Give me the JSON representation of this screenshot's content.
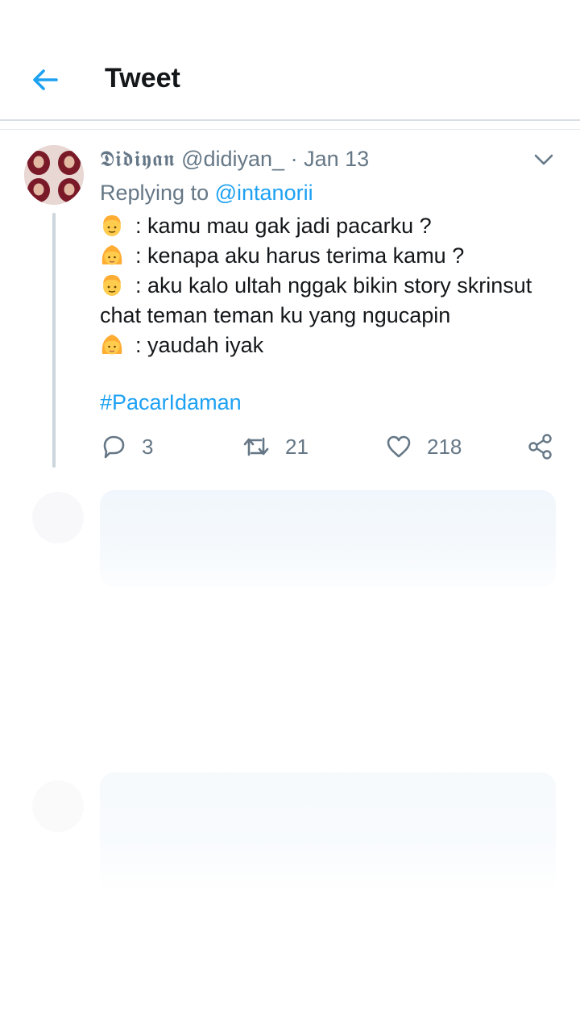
{
  "header": {
    "title": "Tweet",
    "back_icon": "arrow-left-icon"
  },
  "tweet": {
    "display_name": "𝕯𝖎𝖉𝖎𝖞𝖆𝖓",
    "handle": "@didiyan_",
    "separator": "·",
    "date": "Jan 13",
    "replying_prefix": "Replying to",
    "replying_to": "@intanorii",
    "lines": [
      {
        "emoji": "boy-emoji",
        "text": ": kamu mau gak jadi pacarku ?"
      },
      {
        "emoji": "girl-emoji",
        "text": ": kenapa aku harus terima kamu ?"
      },
      {
        "emoji": "boy-emoji",
        "text": ": aku kalo ultah nggak bikin story skrinsut chat teman teman ku yang ngucapin"
      },
      {
        "emoji": "girl-emoji",
        "text": ": yaudah iyak"
      }
    ],
    "hashtag": "#PacarIdaman",
    "actions": {
      "replies": "3",
      "retweets": "21",
      "likes": "218"
    }
  },
  "colors": {
    "accent": "#1da1f2",
    "muted": "#657786",
    "text": "#14171a"
  }
}
